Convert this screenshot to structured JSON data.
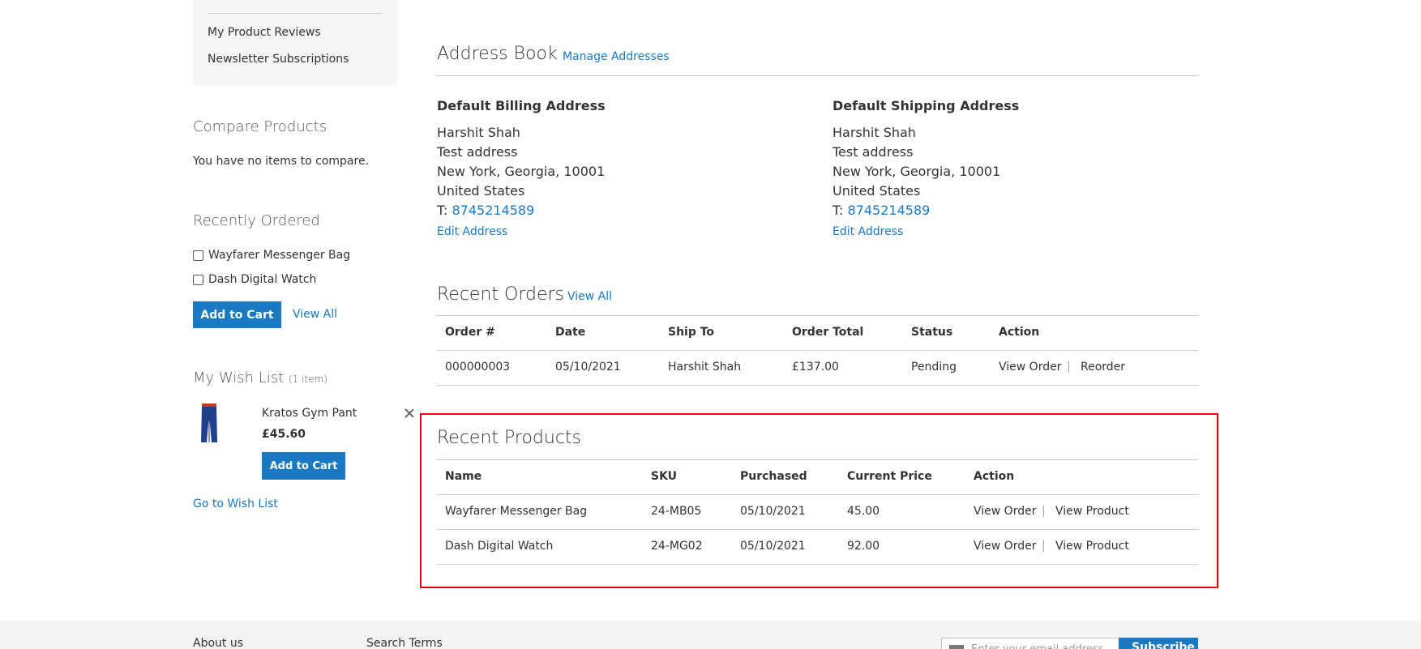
{
  "sidebar": {
    "nav_items": [
      "My Product Reviews",
      "Newsletter Subscriptions"
    ],
    "compare": {
      "title": "Compare Products",
      "empty_text": "You have no items to compare."
    },
    "recently_ordered": {
      "title": "Recently Ordered",
      "items": [
        "Wayfarer Messenger Bag",
        "Dash Digital Watch"
      ],
      "add_to_cart": "Add to Cart",
      "view_all": "View All"
    },
    "wishlist": {
      "title": "My Wish List",
      "count": "(1 item)",
      "product_name": "Kratos Gym Pant",
      "product_price": "£45.60",
      "add_to_cart": "Add to Cart",
      "go_to": "Go to Wish List"
    }
  },
  "address_book": {
    "title": "Address Book",
    "manage_link": "Manage Addresses",
    "billing": {
      "title": "Default Billing Address",
      "lines": [
        "Harshit Shah",
        "Test address",
        "New York, Georgia, 10001",
        "United States"
      ],
      "phone_label": "T:",
      "phone": "8745214589",
      "edit": "Edit Address"
    },
    "shipping": {
      "title": "Default Shipping Address",
      "lines": [
        "Harshit Shah",
        "Test address",
        "New York, Georgia, 10001",
        "United States"
      ],
      "phone_label": "T:",
      "phone": "8745214589",
      "edit": "Edit Address"
    }
  },
  "recent_orders": {
    "title": "Recent Orders",
    "view_all": "View All",
    "headers": [
      "Order #",
      "Date",
      "Ship To",
      "Order Total",
      "Status",
      "Action"
    ],
    "rows": [
      {
        "order": "000000003",
        "date": "05/10/2021",
        "ship_to": "Harshit Shah",
        "total": "£137.00",
        "status": "Pending",
        "view": "View Order",
        "reorder": "Reorder"
      }
    ]
  },
  "recent_products": {
    "title": "Recent Products",
    "headers": [
      "Name",
      "SKU",
      "Purchased",
      "Current Price",
      "Action"
    ],
    "rows": [
      {
        "name": "Wayfarer Messenger Bag",
        "sku": "24-MB05",
        "purchased": "05/10/2021",
        "price": "45.00",
        "view_order": "View Order",
        "view_product": "View Product"
      },
      {
        "name": "Dash Digital Watch",
        "sku": "24-MG02",
        "purchased": "05/10/2021",
        "price": "92.00",
        "view_order": "View Order",
        "view_product": "View Product"
      }
    ],
    "separator": "|"
  },
  "footer": {
    "links": [
      "About us",
      "Search Terms"
    ],
    "email_placeholder": "Enter your email address",
    "subscribe": "Subscribe"
  },
  "colors": {
    "accent": "#1979c3",
    "highlight": "#e00000"
  }
}
